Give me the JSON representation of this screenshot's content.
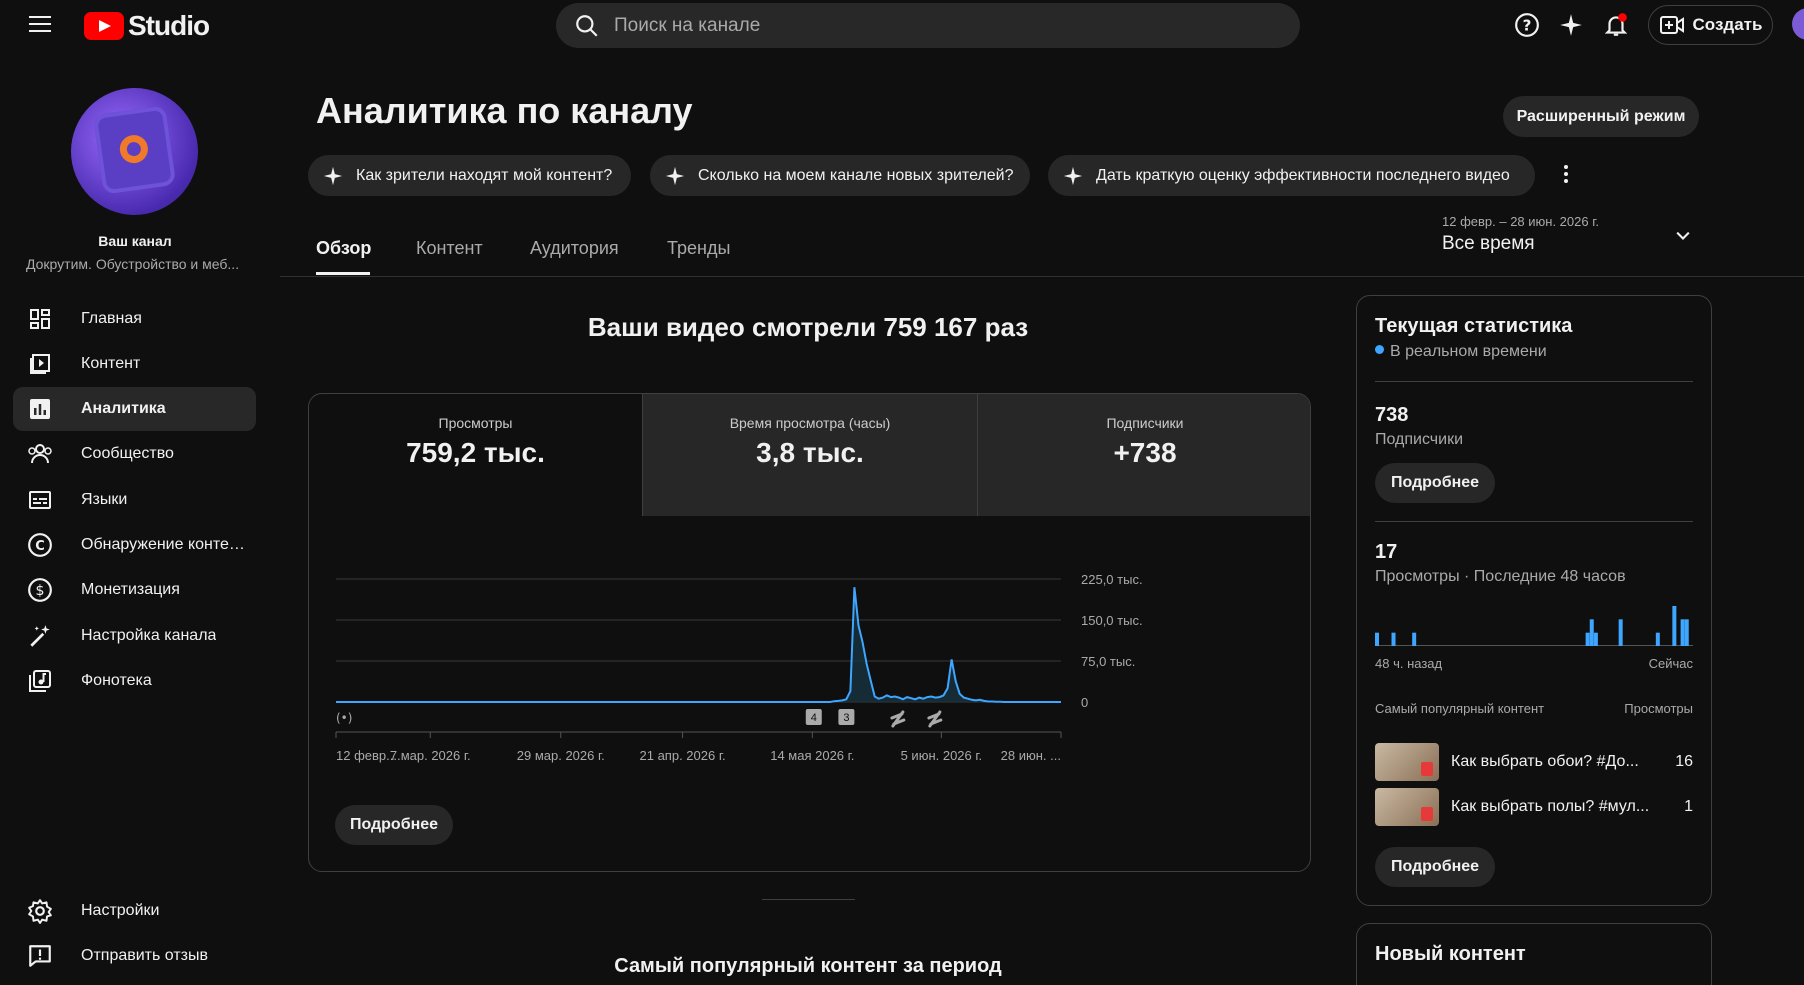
{
  "header": {
    "logo_text": "Studio",
    "search_placeholder": "Поиск на канале",
    "create_label": "Создать"
  },
  "sidebar": {
    "channel_name": "Ваш канал",
    "channel_desc": "Докрутим. Обустройство и меб...",
    "items": [
      {
        "label": "Главная",
        "icon": "dashboard-icon"
      },
      {
        "label": "Контент",
        "icon": "content-icon"
      },
      {
        "label": "Аналитика",
        "icon": "analytics-icon",
        "active": true
      },
      {
        "label": "Сообщество",
        "icon": "community-icon"
      },
      {
        "label": "Языки",
        "icon": "subtitles-icon"
      },
      {
        "label": "Обнаружение контен...",
        "icon": "copyright-icon"
      },
      {
        "label": "Монетизация",
        "icon": "monetization-icon"
      },
      {
        "label": "Настройка канала",
        "icon": "customization-icon"
      },
      {
        "label": "Фонотека",
        "icon": "audio-library-icon"
      }
    ],
    "bottom": [
      {
        "label": "Настройки",
        "icon": "gear-icon"
      },
      {
        "label": "Отправить отзыв",
        "icon": "feedback-icon"
      }
    ]
  },
  "main": {
    "title": "Аналитика по каналу",
    "advanced_mode": "Расширенный режим",
    "chips": [
      "Как зрители находят мой контент?",
      "Сколько на моем канале новых зрителей?",
      "Дать краткую оценку эффективности последнего видео"
    ],
    "tabs": [
      "Обзор",
      "Контент",
      "Аудитория",
      "Тренды"
    ],
    "date_range": "12 февр. – 28 июн. 2026 г.",
    "date_label": "Все время",
    "headline": "Ваши видео смотрели 759 167 раз",
    "metrics": [
      {
        "label": "Просмотры",
        "value": "759,2 тыс."
      },
      {
        "label": "Время просмотра (часы)",
        "value": "3,8 тыс."
      },
      {
        "label": "Подписчики",
        "value": "+738"
      }
    ],
    "more_label": "Подробнее",
    "popular_title": "Самый популярный контент за период"
  },
  "chart_data": {
    "type": "line",
    "series": [
      {
        "values": [
          0,
          0,
          0,
          0,
          0,
          0,
          0,
          0,
          0,
          0,
          0,
          0,
          0,
          0,
          0,
          0,
          0,
          0,
          0,
          0,
          0,
          0,
          0,
          0,
          0,
          0,
          0,
          0,
          0,
          0,
          0,
          0,
          0,
          0,
          0,
          0,
          0,
          0,
          0,
          0,
          0,
          0,
          0,
          0,
          0,
          0,
          0,
          0,
          0,
          0,
          0,
          0,
          0,
          0,
          0,
          0,
          0,
          0,
          0,
          0,
          0,
          0,
          0,
          0,
          0,
          0,
          0,
          0,
          0,
          0,
          0,
          0,
          0,
          0,
          0,
          0,
          0,
          0,
          0,
          0,
          0,
          0,
          0,
          0,
          0,
          0,
          0,
          0,
          0,
          0,
          0,
          0,
          0,
          0,
          0,
          0,
          0,
          0,
          0,
          0,
          0,
          0,
          0,
          0,
          0,
          0,
          0,
          0,
          0,
          0,
          0,
          0,
          0,
          0,
          0,
          0,
          0,
          0,
          0,
          0,
          0,
          0,
          0,
          1500,
          2000,
          3000,
          5000,
          20000,
          210000,
          140000,
          110000,
          70000,
          40000,
          10000,
          6000,
          8000,
          12000,
          9000,
          10000,
          8000,
          5000,
          9000,
          7000,
          5000,
          8000,
          6000,
          9000,
          10000,
          8000,
          9000,
          12000,
          25000,
          78000,
          38000,
          15000,
          8000,
          6000,
          4000,
          3000,
          4000,
          2000,
          1000,
          1000,
          500,
          500,
          0,
          0,
          0,
          0,
          0,
          0,
          0,
          0,
          0,
          0,
          0,
          0,
          0,
          0,
          0
        ]
      }
    ],
    "y_ticks": [
      "225,0 тыс.",
      "150,0 тыс.",
      "75,0 тыс.",
      "0"
    ],
    "y_tick_values": [
      225000,
      150000,
      75000,
      0
    ],
    "ylim": [
      0,
      225000
    ],
    "x_ticks": [
      "12 февр....",
      "7 мар. 2026 г.",
      "29 мар. 2026 г.",
      "21 апр. 2026 г.",
      "14 мая 2026 г.",
      "5 июн. 2026 г.",
      "28 июн. ..."
    ],
    "markers": [
      "4",
      "3"
    ],
    "grid": true
  },
  "realtime": {
    "title": "Текущая статистика",
    "live": "В реальном времени",
    "subs_value": "738",
    "subs_label": "Подписчики",
    "more_label": "Подробнее",
    "views_value": "17",
    "views_label": "Просмотры · Последние 48 часов",
    "bars": [
      1,
      0,
      0,
      0,
      1,
      0,
      0,
      0,
      0,
      1,
      0,
      0,
      0,
      0,
      0,
      0,
      0,
      0,
      0,
      0,
      0,
      0,
      0,
      0,
      0,
      0,
      0,
      0,
      0,
      0,
      0,
      0,
      0,
      0,
      0,
      0,
      0,
      0,
      0,
      0,
      0,
      0,
      0,
      0,
      0,
      0,
      0,
      0,
      0,
      0,
      0,
      1,
      2,
      1,
      0,
      0,
      0,
      0,
      0,
      2,
      0,
      0,
      0,
      0,
      0,
      0,
      0,
      0,
      1,
      0,
      0,
      0,
      3,
      0,
      2,
      2,
      0
    ],
    "ago_label": "48 ч. назад",
    "now_label": "Сейчас",
    "top_content_label": "Самый популярный контент",
    "views_col_label": "Просмотры",
    "top_items": [
      {
        "title": "Как выбрать обои? #До...",
        "views": "16"
      },
      {
        "title": "Как выбрать полы? #мул...",
        "views": "1"
      }
    ],
    "new_content_title": "Новый контент"
  },
  "colors": {
    "accent": "#3ea6ff",
    "brand": "#ff0000"
  }
}
